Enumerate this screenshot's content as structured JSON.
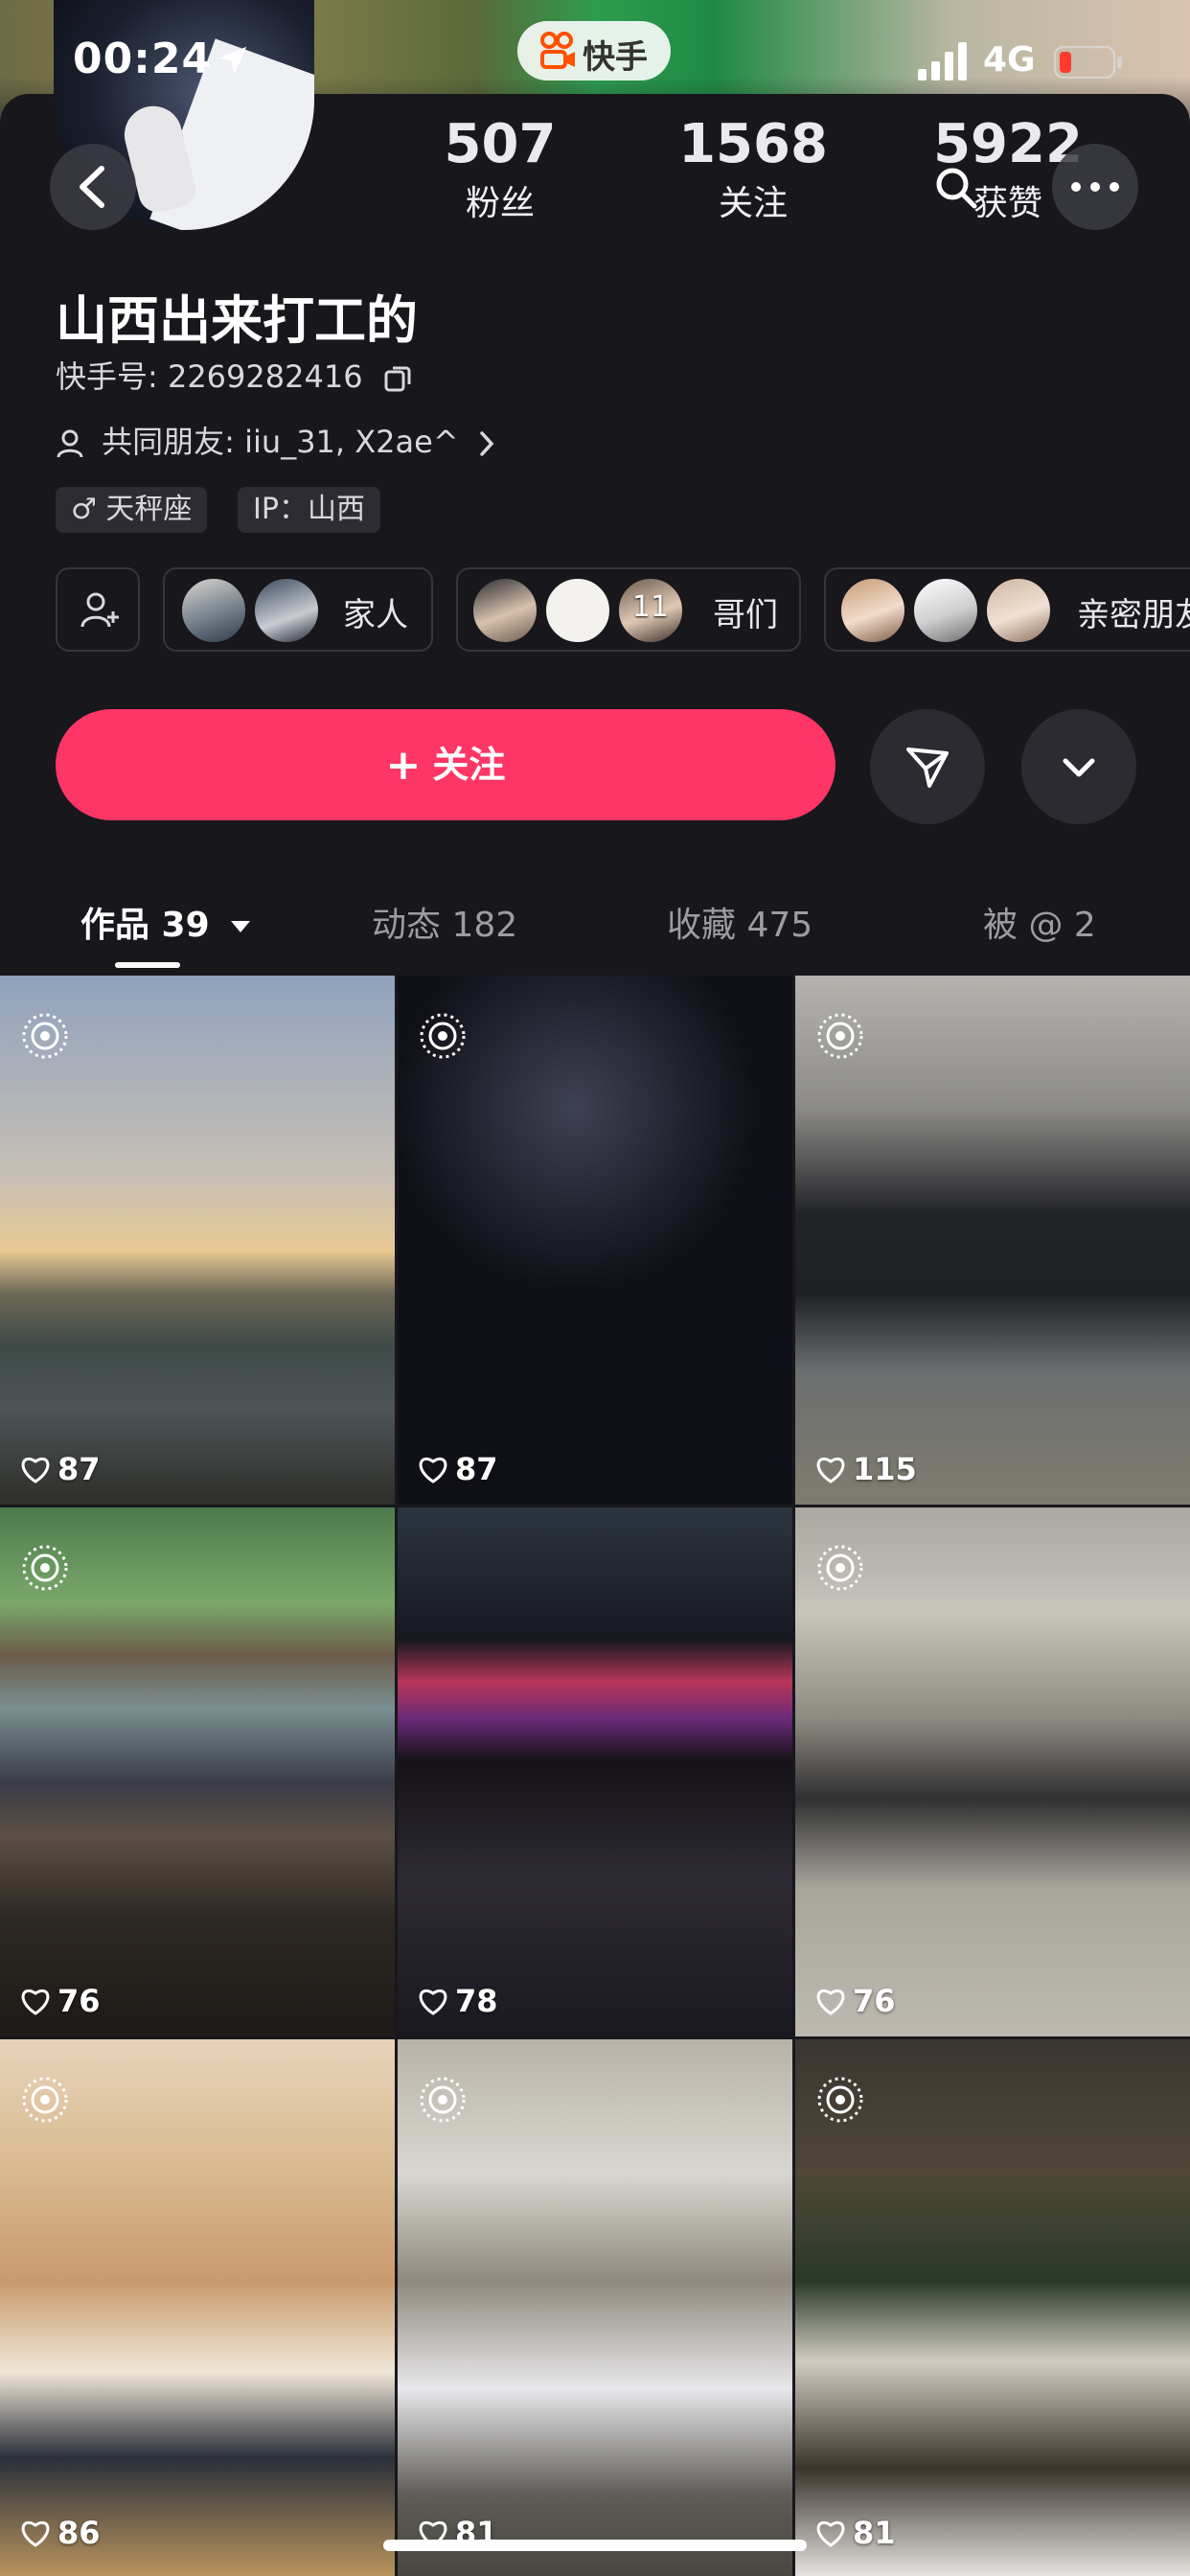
{
  "status_bar": {
    "time": "00:24",
    "network": "4G",
    "app_badge": "快手"
  },
  "profile": {
    "name": "山西出来打工的",
    "kuaishou_id": "快手号: 2269282416",
    "mutual_friends": "共同朋友: iiu_31, X2ae^",
    "tags": [
      "♂ 天秤座",
      "IP：山西"
    ]
  },
  "stats": [
    {
      "value": "507",
      "label": "粉丝"
    },
    {
      "value": "1568",
      "label": "关注"
    },
    {
      "value": "5922",
      "label": "获赞"
    }
  ],
  "groups": [
    {
      "label": "家人"
    },
    {
      "label": "哥们",
      "count": "11"
    },
    {
      "label": "亲密朋友"
    }
  ],
  "actions": {
    "follow_label": "关注"
  },
  "tabs": [
    {
      "label": "作品 39"
    },
    {
      "label": "动态 182"
    },
    {
      "label": "收藏 475"
    },
    {
      "label": "被 @ 2"
    }
  ],
  "videos": [
    {
      "likes": "87"
    },
    {
      "likes": "87"
    },
    {
      "likes": "115"
    },
    {
      "likes": "76"
    },
    {
      "likes": "78"
    },
    {
      "likes": "76"
    },
    {
      "likes": "86"
    },
    {
      "likes": "81"
    },
    {
      "likes": "81"
    }
  ],
  "colors": {
    "accent": "#fe3666",
    "background": "#18171c"
  }
}
